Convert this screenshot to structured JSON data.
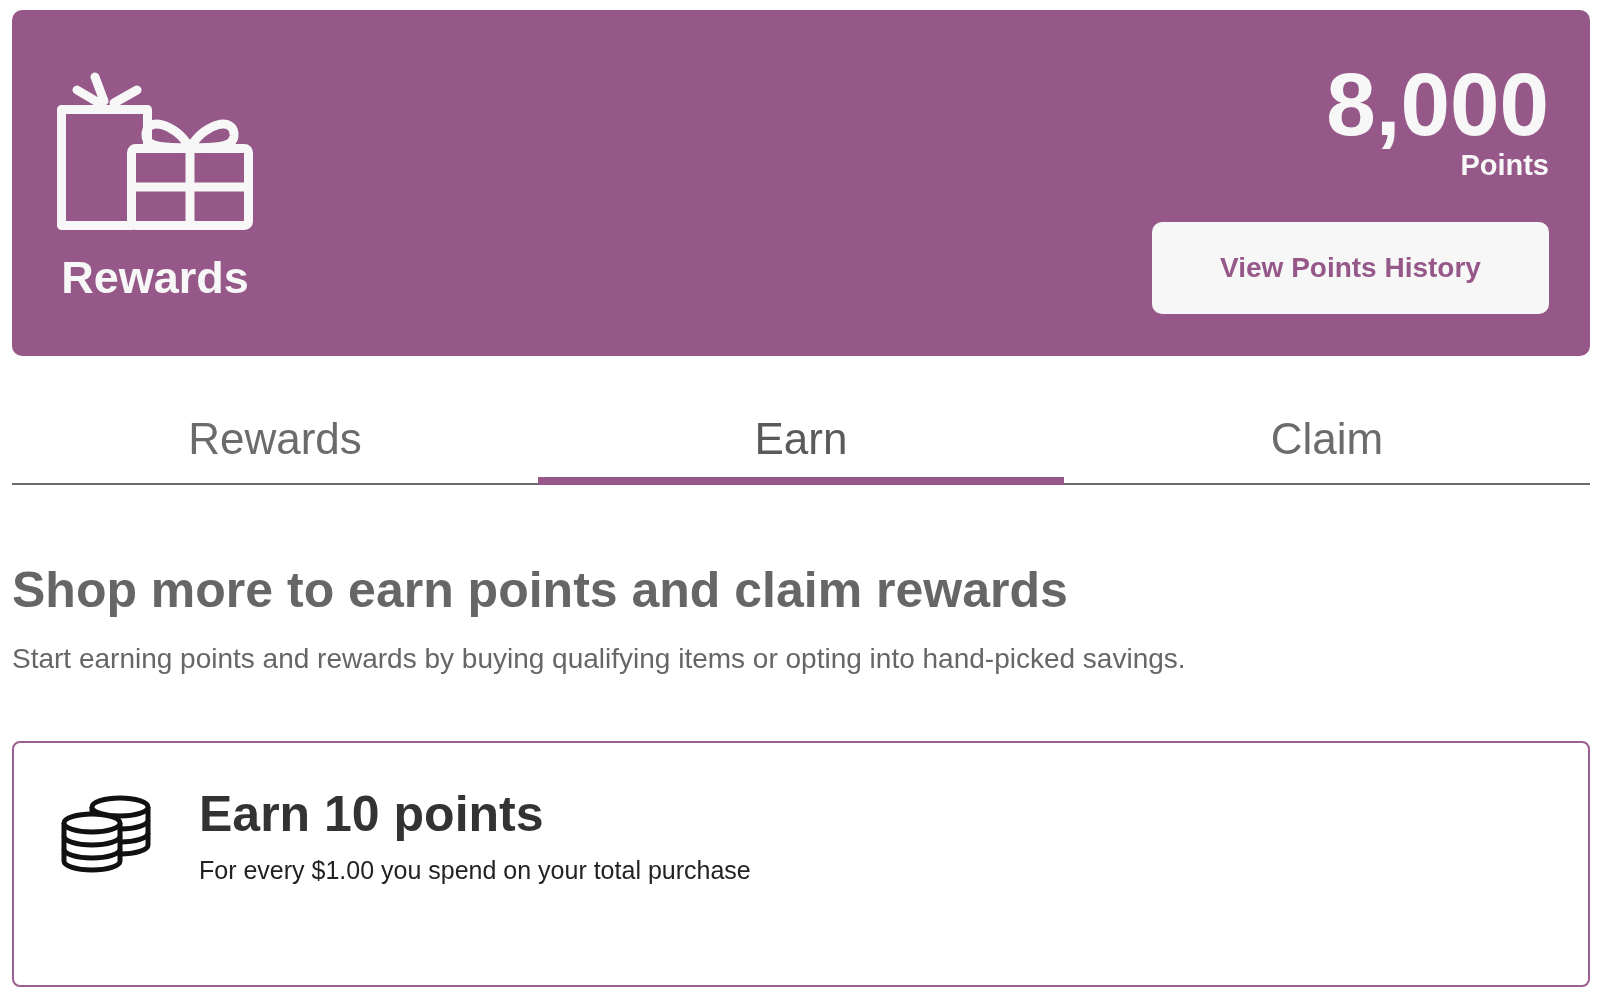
{
  "banner": {
    "title": "Rewards",
    "points_value": "8,000",
    "points_label": "Points",
    "button": "View Points History"
  },
  "tabs": [
    {
      "label": "Rewards",
      "selected": false
    },
    {
      "label": "Earn",
      "selected": true
    },
    {
      "label": "Claim",
      "selected": false
    }
  ],
  "section": {
    "heading": "Shop more to earn points and claim rewards",
    "description": "Start earning points and rewards by buying qualifying items or opting into hand-picked savings."
  },
  "earn_cards": [
    {
      "title": "Earn 10 points",
      "description": "For every $1.00 you spend on your total purchase"
    }
  ]
}
